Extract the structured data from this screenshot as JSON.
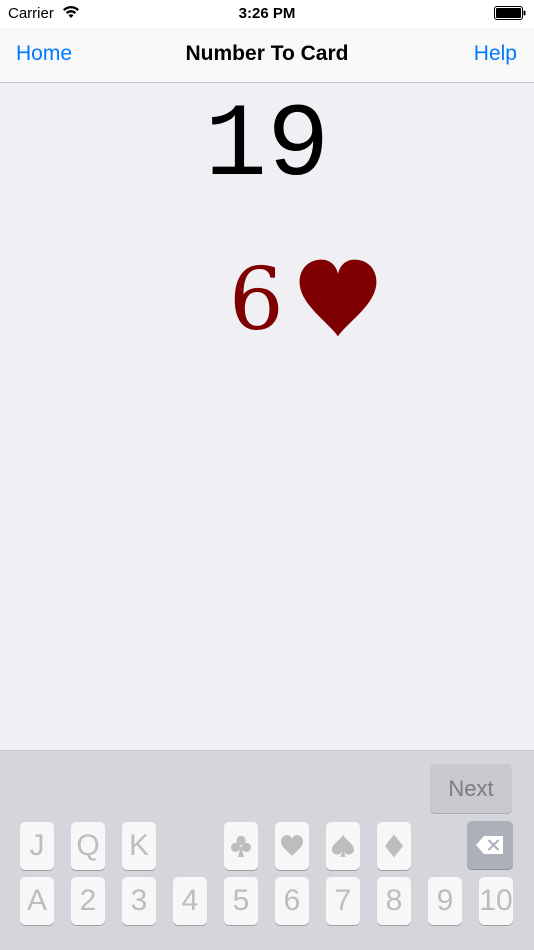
{
  "status_bar": {
    "carrier": "Carrier",
    "time": "3:26 PM",
    "wifi_icon": "wifi-icon",
    "battery_icon": "battery-icon"
  },
  "nav": {
    "home_label": "Home",
    "title": "Number To Card",
    "help_label": "Help"
  },
  "main": {
    "number": "19",
    "card": {
      "rank": "6",
      "suit": "heart",
      "suit_icon": "heart-icon"
    }
  },
  "colors": {
    "accent": "#007aff",
    "card_red": "#7f0000",
    "background": "#efeff4",
    "keyboard_bg": "#d4d6db"
  },
  "keyboard": {
    "next_label": "Next",
    "delete_icon": "backspace-icon",
    "row1_letters": [
      "J",
      "Q",
      "K"
    ],
    "row1_suits": [
      "club-icon",
      "heart-icon",
      "spade-icon",
      "diamond-icon"
    ],
    "row2": [
      "A",
      "2",
      "3",
      "4",
      "5",
      "6",
      "7",
      "8",
      "9",
      "10"
    ]
  }
}
